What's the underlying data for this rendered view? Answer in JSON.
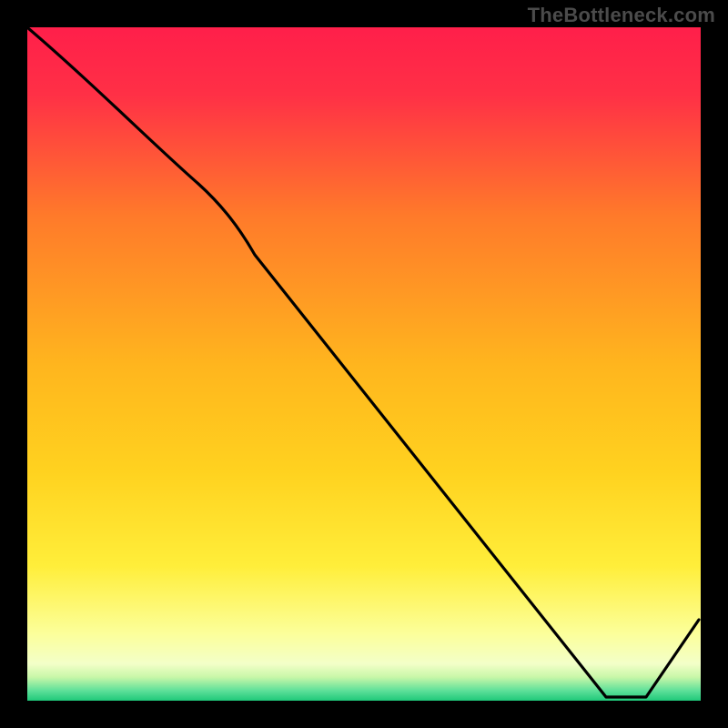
{
  "watermark": "TheBottleneck.com",
  "baseline_label": "",
  "colors": {
    "top": "#ff1f4a",
    "mid_upper": "#ff7a2a",
    "mid": "#ffd21f",
    "mid_lower": "#fff27a",
    "pale": "#f8ffb0",
    "green": "#23d07b",
    "line": "#000000",
    "frame": "#000000"
  },
  "chart_data": {
    "type": "line",
    "title": "",
    "xlabel": "",
    "ylabel": "",
    "xlim": [
      0,
      100
    ],
    "ylim": [
      0,
      100
    ],
    "x": [
      0,
      25,
      86,
      92,
      100
    ],
    "values": [
      100,
      77,
      0,
      0,
      12
    ],
    "annotations": [
      {
        "text": "",
        "x": 89,
        "y": 0
      }
    ],
    "notes": "Values estimated from pixel positions; y=0 is chart baseline, y=100 is top. Curve descends from top-left, inflects near x≈25, reaches zero around x≈86–92, then rises to ≈12 at right edge."
  }
}
